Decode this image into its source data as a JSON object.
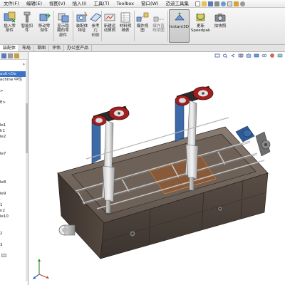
{
  "menubar": {
    "items": [
      "文件(F)",
      "编辑(E)",
      "视图(V)",
      "插入(I)",
      "工具(T)",
      "Toolbox",
      "窗口(W)",
      "迈迪工具集"
    ],
    "quick_icons": [
      "new-icon",
      "open-icon",
      "save-icon",
      "print-icon",
      "undo-icon",
      "select-icon",
      "rebuild-icon",
      "options-icon"
    ]
  },
  "ribbon": {
    "buttons": [
      {
        "id": "insert-parts",
        "icon": "insert-part-icon",
        "lines": [
          "插入零",
          "部件"
        ]
      },
      {
        "id": "smart-fastener",
        "icon": "fastener-icon",
        "lines": [
          "智能扣",
          "件"
        ]
      },
      {
        "id": "move-component",
        "icon": "move-component-icon",
        "lines": [
          "移动零",
          "部件"
        ]
      },
      {
        "id": "show-hidden",
        "icon": "show-hidden-icon",
        "lines": [
          "显示隐",
          "藏的零",
          "部件"
        ]
      },
      {
        "id": "assembly-feature",
        "icon": "assembly-feature-icon",
        "lines": [
          "装配体",
          "特征"
        ]
      },
      {
        "id": "reference-geometry",
        "icon": "reference-geometry-icon",
        "lines": [
          "参考几",
          "何体"
        ]
      },
      {
        "id": "new-motion-study",
        "icon": "motion-study-icon",
        "lines": [
          "新建运",
          "动算例"
        ]
      },
      {
        "id": "bill-of-materials",
        "icon": "bom-icon",
        "lines": [
          "材料明",
          "细表"
        ]
      },
      {
        "id": "exploded-view",
        "icon": "exploded-view-icon",
        "lines": [
          "爆炸视",
          "图"
        ]
      },
      {
        "id": "explode-line-sketch",
        "icon": "explode-line-icon",
        "lines": [
          "爆炸直",
          "线草图"
        ]
      },
      {
        "id": "instant3d",
        "icon": "instant3d-icon",
        "lines": [
          "Instant3D"
        ]
      },
      {
        "id": "update-speedpak",
        "icon": "speedpak-icon",
        "lines": [
          "更新",
          "Speedpak"
        ]
      },
      {
        "id": "take-snapshot",
        "icon": "snapshot-icon",
        "lines": [
          "拍快照"
        ]
      }
    ]
  },
  "tabs": [
    "装配体",
    "布局",
    "草图",
    "评估",
    "办公室产品"
  ],
  "tree": {
    "items": [
      {
        "text": "ault<De",
        "selected": true
      },
      {
        "text": "achine 中性",
        "selected": false
      },
      {
        "text": "",
        "selected": false
      },
      {
        "text": ">",
        "selected": false
      },
      {
        "text": "",
        "selected": false
      },
      {
        "text": "E>",
        "selected": false
      },
      {
        "text": "",
        "selected": false
      },
      {
        "text": "",
        "selected": false
      },
      {
        "text": "",
        "selected": false
      },
      {
        "text": "le1",
        "selected": false
      },
      {
        "text": "h1",
        "selected": false
      },
      {
        "text": "le2",
        "selected": false
      },
      {
        "text": "",
        "selected": false
      },
      {
        "text": "",
        "selected": false
      },
      {
        "text": "le7",
        "selected": false
      },
      {
        "text": "",
        "selected": false
      },
      {
        "text": "",
        "selected": false
      },
      {
        "text": "",
        "selected": false
      },
      {
        "text": "",
        "selected": false
      },
      {
        "text": "le8",
        "selected": false
      },
      {
        "text": "",
        "selected": false
      },
      {
        "text": "le9",
        "selected": false
      },
      {
        "text": "",
        "selected": false
      },
      {
        "text": "1",
        "selected": false
      },
      {
        "text": "n2",
        "selected": false
      },
      {
        "text": "le10",
        "selected": false
      },
      {
        "text": "",
        "selected": false
      },
      {
        "text": "",
        "selected": false
      },
      {
        "text": "2",
        "selected": false
      },
      {
        "text": "",
        "selected": false
      },
      {
        "text": "3",
        "selected": false
      }
    ]
  },
  "view_toolbar": [
    "zoom-to-fit-icon",
    "zoom-area-icon",
    "previous-view-icon",
    "section-view-icon",
    "view-orientation-icon",
    "display-style-icon",
    "hide-show-icon",
    "edit-appearance-icon",
    "apply-scene-icon",
    "view-settings-icon"
  ],
  "colors": {
    "machine_body": "#4a4038",
    "frame_grey": "#9b9b9b",
    "motor_red": "#8a1c1c",
    "highlight_orange": "#c8782a",
    "selection_blue": "#3b74c7"
  }
}
